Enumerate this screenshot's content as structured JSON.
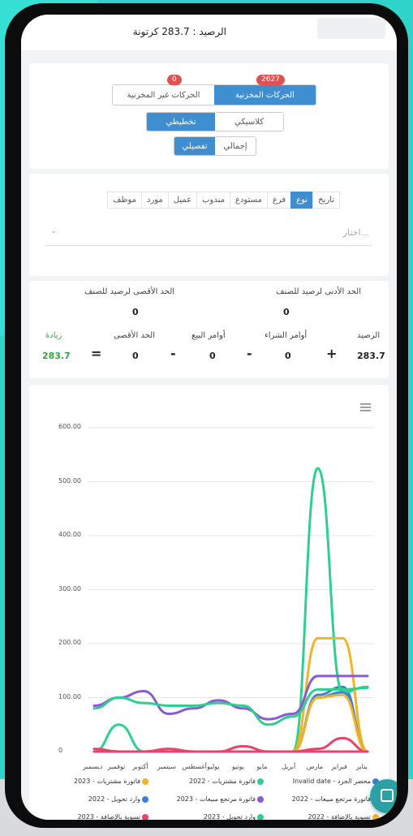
{
  "header": {
    "balance": "الرصيد : 283.7 كرتونة"
  },
  "view_toggle": {
    "stock_label": "الحركات المخزنية",
    "stock_count": "2627",
    "nonstock_label": "الحركات غير المخزنية",
    "nonstock_count": "0"
  },
  "mode_toggle": {
    "classic": "كلاسيكي",
    "chart": "تخطيطي"
  },
  "detail_toggle": {
    "total": "إجمالي",
    "detailed": "تفصيلي"
  },
  "filter": {
    "tabs": [
      "تاريخ",
      "نوع",
      "فرع",
      "مستودع",
      "مندوب",
      "عميل",
      "مورد",
      "موظف"
    ],
    "active_index": 1,
    "placeholder": "اختار..."
  },
  "limits": {
    "min_label": "الحد الأدنى لرصيد للصنف",
    "min_value": "0",
    "max_label": "الحد الأقصى لرصيد للصنف",
    "max_value": "0"
  },
  "equation": {
    "balance_label": "الرصيد",
    "balance_value": "283.7",
    "purchase_label": "أوامر الشراء",
    "purchase_value": "0",
    "sale_label": "أوامر البيع",
    "sale_value": "0",
    "max_label": "الحد الأقصى",
    "max_value": "0",
    "result_label": "زيادة",
    "result_value": "283.7",
    "plus": "+",
    "minus": "-",
    "equals": "="
  },
  "menu_icon": "menu-icon",
  "colors": {
    "accent": "#3e8ed0",
    "badge": "#e05252",
    "increase": "#3aa046"
  },
  "chart_data": {
    "type": "line",
    "ylim": [
      0,
      600
    ],
    "yticks": [
      "600.00",
      "500.00",
      "400.00",
      "300.00",
      "200.00",
      "100.00",
      "0"
    ],
    "categories": [
      "يناير",
      "فبراير",
      "مارس",
      "أبريل",
      "مايو",
      "يونيو",
      "يوليو",
      "أغسطس",
      "سبتمبر",
      "أكتوبر",
      "نوفمبر",
      "ديسمبر"
    ],
    "series": [
      {
        "name": "محضر الجرد - Invalid date",
        "color": "#3b82d6",
        "values": [
          0,
          120,
          105,
          0,
          0,
          0,
          0,
          0,
          0,
          0,
          0,
          0
        ]
      },
      {
        "name": "فاتورة مشتريات - 2022",
        "color": "#2fd08f",
        "values": [
          120,
          110,
          525,
          0,
          0,
          0,
          0,
          0,
          0,
          0,
          50,
          0
        ]
      },
      {
        "name": "فاتورة مشتريات - 2023",
        "color": "#f0b429",
        "values": [
          0,
          210,
          210,
          0,
          0,
          0,
          0,
          0,
          0,
          0,
          0,
          0
        ]
      },
      {
        "name": "فاتورة مرتجع مبيعات - 2022",
        "color": "#e6446a",
        "values": [
          0,
          25,
          5,
          0,
          0,
          10,
          0,
          0,
          5,
          0,
          0,
          5
        ]
      },
      {
        "name": "فاتورة مرتجع مبيعات - 2023",
        "color": "#8a5ad6",
        "values": [
          140,
          140,
          140,
          70,
          60,
          80,
          95,
          80,
          70,
          112,
          100,
          85
        ]
      },
      {
        "name": "وارد تحويل - 2022",
        "color": "#3b82d6",
        "values": [
          0,
          110,
          100,
          0,
          0,
          0,
          0,
          0,
          0,
          0,
          0,
          0
        ]
      },
      {
        "name": "تسوية بالإضافة - 2022",
        "color": "#f0b429",
        "values": [
          0,
          105,
          100,
          0,
          0,
          0,
          0,
          0,
          0,
          0,
          0,
          0
        ]
      },
      {
        "name": "وارد تحويل - 2023",
        "color": "#2fd08f",
        "values": [
          118,
          115,
          115,
          65,
          50,
          85,
          90,
          85,
          85,
          90,
          100,
          80
        ]
      },
      {
        "name": "تسوية بالإضافة - 2023",
        "color": "#e6446a",
        "values": [
          0,
          0,
          0,
          0,
          0,
          0,
          0,
          0,
          0,
          0,
          0,
          0
        ]
      }
    ]
  }
}
